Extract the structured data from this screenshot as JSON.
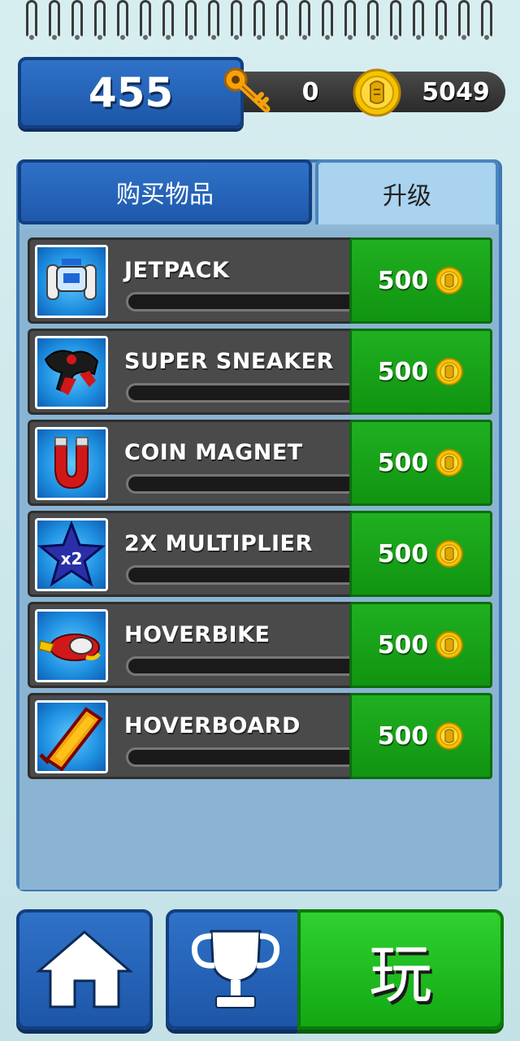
{
  "header": {
    "score": "455",
    "keys": "0",
    "coins": "5049"
  },
  "tabs": {
    "buy_items": "购买物品",
    "upgrade": "升级"
  },
  "upgrades": [
    {
      "name": "JETPACK",
      "price": "500",
      "icon": "jetpack-icon",
      "progress": 0
    },
    {
      "name": "SUPER SNEAKER",
      "price": "500",
      "icon": "sneaker-icon",
      "progress": 0
    },
    {
      "name": "COIN MAGNET",
      "price": "500",
      "icon": "magnet-icon",
      "progress": 0
    },
    {
      "name": "2X MULTIPLIER",
      "price": "500",
      "icon": "star-multiplier-icon",
      "icon_text": "x2",
      "progress": 0
    },
    {
      "name": "HOVERBIKE",
      "price": "500",
      "icon": "hoverbike-icon",
      "progress": 0
    },
    {
      "name": "HOVERBOARD",
      "price": "500",
      "icon": "hoverboard-icon",
      "progress": 0
    }
  ],
  "bottom_nav": {
    "home_icon": "home-icon",
    "trophy_icon": "trophy-icon",
    "play_label": "玩"
  },
  "colors": {
    "accent_blue": "#1d56a8",
    "buy_green": "#119411",
    "coin_gold": "#f5b800",
    "panel_bg": "#8fb9d7"
  }
}
